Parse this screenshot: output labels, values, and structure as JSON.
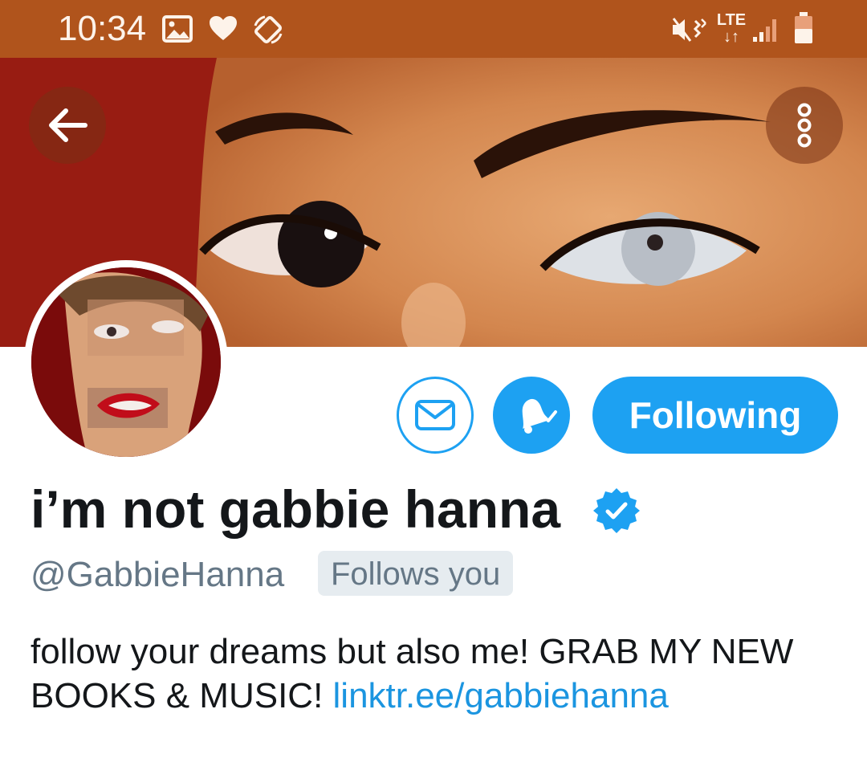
{
  "status_bar": {
    "time": "10:34",
    "left_icons": [
      "image-icon",
      "heart-icon",
      "rotate-icon"
    ],
    "right_icons": [
      "mute-vibrate-icon",
      "lte-icon",
      "signal-icon",
      "battery-icon"
    ],
    "network": "LTE"
  },
  "header": {
    "back_icon": "arrow-left-icon",
    "more_icon": "more-vertical-icon"
  },
  "profile": {
    "display_name": "i’m not gabbie hanna",
    "verified": true,
    "handle": "@GabbieHanna",
    "follows_you_badge": "Follows you",
    "bio_text": "follow your dreams but also me! GRAB MY NEW BOOKS & MUSIC! ",
    "bio_link": "linktr.ee/gabbiehanna"
  },
  "actions": {
    "message_icon": "envelope-icon",
    "notifications_icon": "bell-check-icon",
    "follow_label": "Following"
  },
  "colors": {
    "status_bar": "#b0541c",
    "accent": "#1da1f2",
    "link": "#1b95e0",
    "secondary_text": "#657786",
    "badge_bg": "#e6ecf0"
  }
}
